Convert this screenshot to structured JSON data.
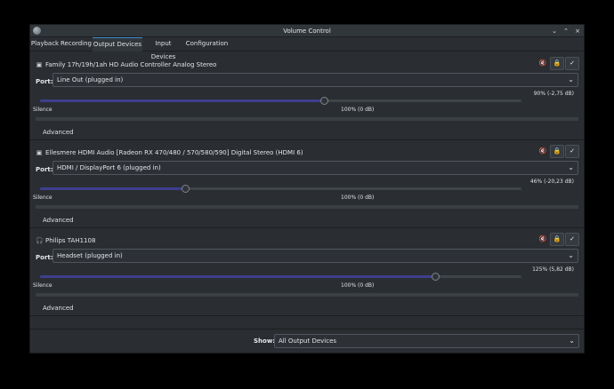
{
  "window": {
    "title": "Volume Control"
  },
  "tabs": [
    {
      "label": "Playback"
    },
    {
      "label": "Recording"
    },
    {
      "label": "Output Devices"
    },
    {
      "label": "Input Devices"
    },
    {
      "label": "Configuration"
    }
  ],
  "active_tab": "Output Devices",
  "controls": {
    "minimize_glyph": "⌄",
    "maximize_glyph": "⌃",
    "close_glyph": "×"
  },
  "common": {
    "port_label": "Port:",
    "silence_label": "Silence",
    "unity_label": "100% (0 dB)",
    "advanced_label": "Advanced"
  },
  "devices": [
    {
      "icon": "sound-card-icon",
      "name": "Family 17h/19h/1ah HD Audio Controller Analog Stereo",
      "port": "Line Out (plugged in)",
      "volume_text": "90% (-2,75 dB)",
      "volume_fraction": 0.59,
      "locked": true,
      "default": true
    },
    {
      "icon": "sound-card-icon",
      "name": "Ellesmere HDMI Audio [Radeon RX 470/480 / 570/580/590] Digital Stereo (HDMI 6)",
      "port": "HDMI / DisplayPort 6 (plugged in)",
      "volume_text": "46% (-20,23 dB)",
      "volume_fraction": 0.302,
      "locked": true,
      "default": false
    },
    {
      "icon": "headphones-icon",
      "name": "Philips TAH1108",
      "port": "Headset (plugged in)",
      "volume_text": "125% (5,82 dB)",
      "volume_fraction": 0.82,
      "locked": true,
      "default": false
    }
  ],
  "footer": {
    "show_label": "Show:",
    "show_value": "All Output Devices"
  },
  "colors": {
    "accent": "#3d8fd1",
    "slider_fill": "#3e3f8e",
    "window_bg": "#2a2e32"
  }
}
